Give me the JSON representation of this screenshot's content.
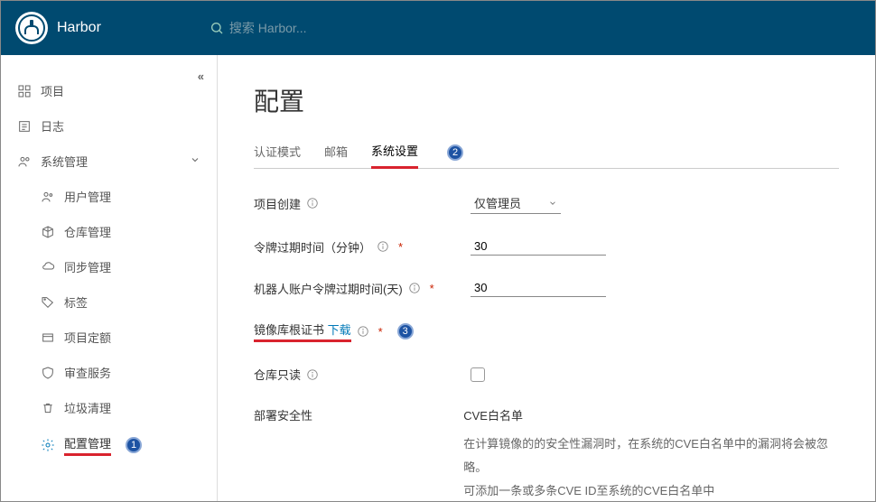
{
  "header": {
    "brand": "Harbor",
    "search_placeholder": "搜索 Harbor..."
  },
  "sidebar": {
    "items": [
      {
        "label": "项目"
      },
      {
        "label": "日志"
      },
      {
        "label": "系统管理"
      }
    ],
    "subitems": [
      {
        "label": "用户管理"
      },
      {
        "label": "仓库管理"
      },
      {
        "label": "同步管理"
      },
      {
        "label": "标签"
      },
      {
        "label": "项目定额"
      },
      {
        "label": "审查服务"
      },
      {
        "label": "垃圾清理"
      },
      {
        "label": "配置管理"
      }
    ],
    "badge1": "1"
  },
  "page": {
    "title": "配置",
    "tabs": [
      {
        "label": "认证模式"
      },
      {
        "label": "邮箱"
      },
      {
        "label": "系统设置"
      }
    ],
    "badge2": "2",
    "badge3": "3"
  },
  "form": {
    "project_create_label": "项目创建",
    "project_create_value": "仅管理员",
    "token_expiry_label": "令牌过期时间（分钟）",
    "token_expiry_value": "30",
    "robot_expiry_label": "机器人账户令牌过期时间(天)",
    "robot_expiry_value": "30",
    "cert_label": "镜像库根证书",
    "cert_download": "下载",
    "readonly_label": "仓库只读",
    "deploy_label": "部署安全性",
    "cve_title": "CVE白名单",
    "cve_desc1": "在计算镜像的的安全性漏洞时，在系统的CVE白名单中的漏洞将会被忽略。",
    "cve_desc2": "可添加一条或多条CVE ID至系统的CVE白名单中"
  }
}
